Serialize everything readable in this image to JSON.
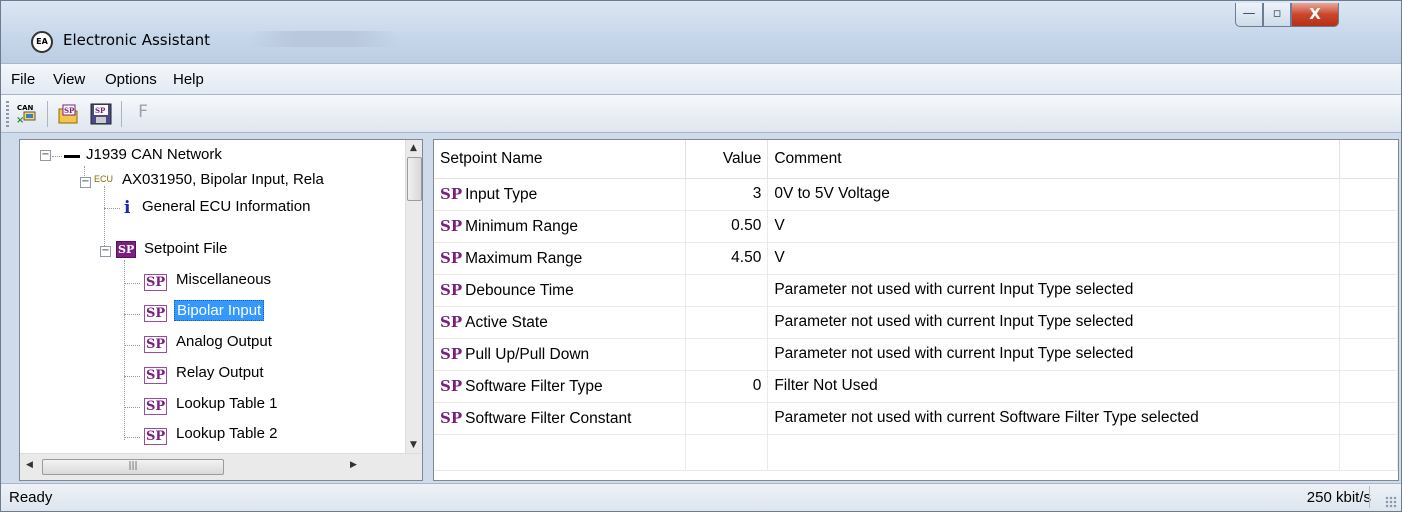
{
  "window": {
    "title": "Electronic Assistant",
    "icon": "EA",
    "minimize": "—",
    "maximize": "▫",
    "close": "X"
  },
  "menu": [
    "File",
    "View",
    "Options",
    "Help"
  ],
  "toolbar": {
    "can_label": "CAN",
    "sp1": "SP",
    "sp2": "SP",
    "f_label": "F"
  },
  "tree": {
    "network": "J1939 CAN Network",
    "ecu_prefix": "ECU",
    "ecu": "AX031950, Bipolar Input, Rela",
    "general": "General ECU Information",
    "info_glyph": "i",
    "setpoint_file": "Setpoint File",
    "items": [
      "Miscellaneous",
      "Bipolar Input",
      "Analog Output",
      "Relay Output",
      "Lookup Table 1",
      "Lookup Table 2"
    ],
    "selected_index": 1,
    "sp_tag": "SP"
  },
  "table": {
    "columns": [
      "Setpoint Name",
      "Value",
      "Comment"
    ],
    "sp_tag": "SP",
    "rows": [
      {
        "name": "Input Type",
        "value": "3",
        "comment": "0V to 5V Voltage"
      },
      {
        "name": "Minimum Range",
        "value": "0.50",
        "comment": "V"
      },
      {
        "name": "Maximum Range",
        "value": "4.50",
        "comment": "V"
      },
      {
        "name": "Debounce Time",
        "value": "",
        "comment": "Parameter not used with current Input Type selected"
      },
      {
        "name": "Active State",
        "value": "",
        "comment": "Parameter not used with current Input Type selected"
      },
      {
        "name": "Pull Up/Pull Down",
        "value": "",
        "comment": "Parameter not used with current Input Type selected"
      },
      {
        "name": "Software Filter Type",
        "value": "0",
        "comment": "Filter Not Used"
      },
      {
        "name": "Software Filter Constant",
        "value": "",
        "comment": "Parameter not used with current Software Filter Type selected"
      }
    ]
  },
  "status": {
    "left": "Ready",
    "right": "250 kbit/s"
  }
}
